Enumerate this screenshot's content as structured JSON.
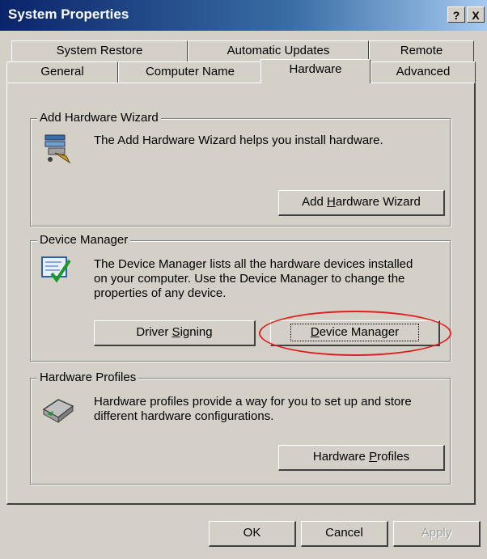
{
  "window": {
    "title": "System Properties",
    "help_glyph": "?",
    "close_glyph": "X"
  },
  "tabs": {
    "row1": [
      "System Restore",
      "Automatic Updates",
      "Remote"
    ],
    "row2": [
      "General",
      "Computer Name",
      "Hardware",
      "Advanced"
    ],
    "selected": "Hardware"
  },
  "add_hardware": {
    "group_label": "Add Hardware Wizard",
    "description": "The Add Hardware Wizard helps you install hardware.",
    "button": {
      "pre": "Add ",
      "key": "H",
      "post": "ardware Wizard"
    }
  },
  "device_manager": {
    "group_label": "Device Manager",
    "description_lines": [
      "The Device Manager lists all the hardware devices installed",
      "on your computer. Use the Device Manager to change the",
      "properties of any device."
    ],
    "driver_button": {
      "pre": "Driver ",
      "key": "S",
      "post": "igning"
    },
    "dm_button": {
      "pre": "",
      "key": "D",
      "post": "evice Manager"
    },
    "highlight_color": "#e02020"
  },
  "hardware_profiles": {
    "group_label": "Hardware Profiles",
    "description_lines": [
      "Hardware profiles provide a way for you to set up and store",
      "different hardware configurations."
    ],
    "button": {
      "pre": "Hardware ",
      "key": "P",
      "post": "rofiles"
    }
  },
  "footer": {
    "ok": "OK",
    "cancel": "Cancel",
    "apply": "Apply"
  },
  "icons": [
    "add-hardware-icon",
    "device-manager-icon",
    "hardware-profiles-icon"
  ]
}
